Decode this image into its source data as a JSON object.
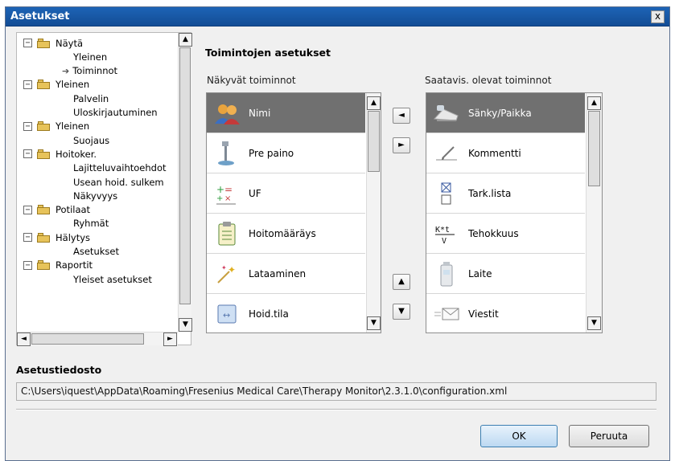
{
  "window": {
    "title": "Asetukset",
    "close_label": "x"
  },
  "tree": {
    "items": [
      {
        "label": "Näytä",
        "type": "group",
        "expander": "−"
      },
      {
        "label": "Yleinen",
        "type": "child"
      },
      {
        "label": "Toiminnot",
        "type": "child-current"
      },
      {
        "label": "Yleinen",
        "type": "group",
        "expander": "−"
      },
      {
        "label": "Palvelin",
        "type": "child"
      },
      {
        "label": "Uloskirjautuminen",
        "type": "child"
      },
      {
        "label": "Yleinen",
        "type": "group",
        "expander": "−"
      },
      {
        "label": "Suojaus",
        "type": "child"
      },
      {
        "label": "Hoitoker.",
        "type": "group",
        "expander": "−"
      },
      {
        "label": "Lajitteluvaihtoehdot",
        "type": "child"
      },
      {
        "label": "Usean hoid. sulkem",
        "type": "child"
      },
      {
        "label": "Näkyvyys",
        "type": "child"
      },
      {
        "label": "Potilaat",
        "type": "group",
        "expander": "−"
      },
      {
        "label": "Ryhmät",
        "type": "child"
      },
      {
        "label": "Hälytys",
        "type": "group",
        "expander": "−"
      },
      {
        "label": "Asetukset",
        "type": "child"
      },
      {
        "label": "Raportit",
        "type": "group",
        "expander": "−"
      },
      {
        "label": "Yleiset asetukset",
        "type": "child"
      }
    ]
  },
  "main": {
    "section_title": "Toimintojen asetukset",
    "visible_label": "Näkyvät toiminnot",
    "available_label": "Saatavis. olevat toiminnot",
    "visible_items": [
      {
        "label": "Nimi",
        "icon": "people-icon",
        "selected": true
      },
      {
        "label": "Pre paino",
        "icon": "scale-icon",
        "selected": false
      },
      {
        "label": "UF",
        "icon": "uf-icon",
        "selected": false
      },
      {
        "label": "Hoitomääräys",
        "icon": "clipboard-icon",
        "selected": false
      },
      {
        "label": "Lataaminen",
        "icon": "sparkle-icon",
        "selected": false
      },
      {
        "label": "Hoid.tila",
        "icon": "status-icon",
        "selected": false
      }
    ],
    "available_items": [
      {
        "label": "Sänky/Paikka",
        "icon": "bed-icon",
        "selected": true
      },
      {
        "label": "Kommentti",
        "icon": "comment-icon",
        "selected": false
      },
      {
        "label": "Tark.lista",
        "icon": "checklist-icon",
        "selected": false
      },
      {
        "label": "Tehokkuus",
        "icon": "efficiency-icon",
        "selected": false
      },
      {
        "label": "Laite",
        "icon": "device-icon",
        "selected": false
      },
      {
        "label": "Viestit",
        "icon": "envelope-icon",
        "selected": false
      }
    ],
    "move_buttons": {
      "left": "◄",
      "right": "►",
      "up": "▲",
      "down": "▼"
    }
  },
  "config": {
    "label": "Asetustiedosto",
    "path": "C:\\Users\\iquest\\AppData\\Roaming\\Fresenius Medical Care\\Therapy Monitor\\2.3.1.0\\configuration.xml"
  },
  "buttons": {
    "ok": "OK",
    "cancel": "Peruuta"
  },
  "colors": {
    "titlebar": "#1d64b6",
    "selected_row": "#707070"
  }
}
